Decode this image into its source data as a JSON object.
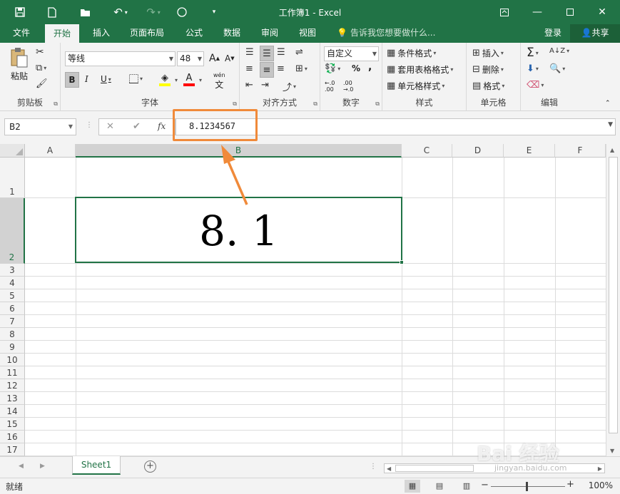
{
  "titlebar": {
    "title": "工作簿1 - Excel",
    "icons": [
      "save-icon",
      "new-file-icon",
      "open-folder-icon",
      "undo-icon",
      "redo-icon",
      "circle-icon",
      "customize-icon"
    ],
    "window_buttons": [
      "ribbon-display-icon",
      "minimize-icon",
      "maximize-icon",
      "close-icon"
    ]
  },
  "tabs": {
    "items": [
      "文件",
      "开始",
      "插入",
      "页面布局",
      "公式",
      "数据",
      "审阅",
      "视图"
    ],
    "active": "开始",
    "tell_me": "告诉我您想要做什么...",
    "login": "登录",
    "share": "共享"
  },
  "ribbon": {
    "clipboard": {
      "paste": "粘贴",
      "label": "剪贴板"
    },
    "font": {
      "name": "等线",
      "size": "48",
      "bold": "B",
      "italic": "I",
      "underline": "U",
      "grow": "A",
      "shrink": "A",
      "color_letter": "A",
      "phonetic": "wén",
      "label": "字体"
    },
    "alignment": {
      "label": "对齐方式"
    },
    "number": {
      "format": "自定义",
      "percent": "%",
      "comma": ",",
      "label": "数字"
    },
    "styles": {
      "conditional": "条件格式",
      "table": "套用表格格式",
      "cell": "单元格样式",
      "label": "样式"
    },
    "cells": {
      "insert": "插入",
      "delete": "删除",
      "format": "格式",
      "label": "单元格"
    },
    "editing": {
      "label": "编辑"
    },
    "colors": {
      "accent": "#217346",
      "highlight_yellow": "#ffff00",
      "font_red": "#ff0000"
    }
  },
  "formula_bar": {
    "name_box": "B2",
    "fx": "fx",
    "value": "8.1234567"
  },
  "grid": {
    "columns": [
      "A",
      "B",
      "C",
      "D",
      "E",
      "F"
    ],
    "selected_column": "B",
    "rows": [
      "1",
      "2",
      "3",
      "4",
      "5",
      "6",
      "7",
      "8",
      "9",
      "10",
      "11",
      "12",
      "13",
      "14",
      "15",
      "16",
      "17"
    ],
    "selected_row": "2",
    "active_cell": {
      "ref": "B2",
      "display": "8. 1"
    }
  },
  "annotation": {
    "highlight_color": "#f08a3a"
  },
  "sheets": {
    "tabs": [
      "Sheet1"
    ],
    "active": "Sheet1"
  },
  "status": {
    "ready": "就绪",
    "zoom": "100%"
  },
  "watermark": {
    "text": "Bai 经验",
    "url": "jingyan.baidu.com"
  }
}
